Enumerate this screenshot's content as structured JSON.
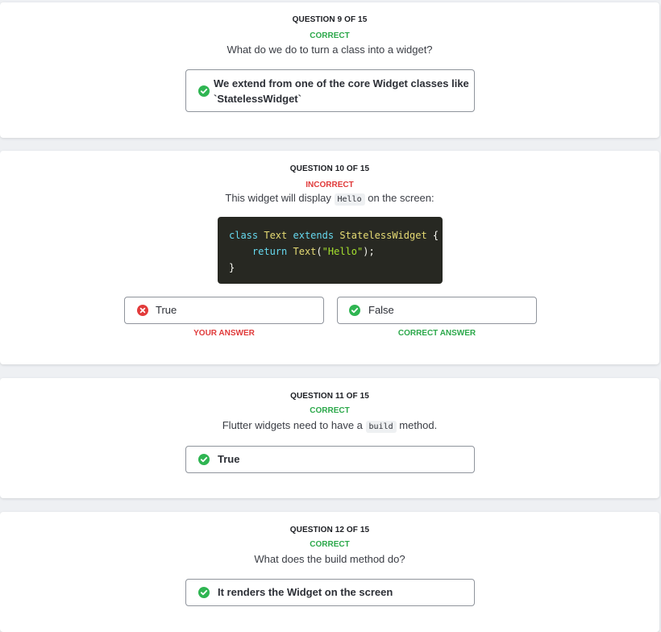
{
  "questions": [
    {
      "number": "QUESTION 9 OF 15",
      "status": "CORRECT",
      "text": "What do we do to turn a class into a widget?",
      "answer": {
        "line1": "We extend from one of the core Widget classes like",
        "line2": "`StatelessWidget`"
      }
    },
    {
      "number": "QUESTION 10 OF 15",
      "status": "INCORRECT",
      "text_before": "This widget will display",
      "code_inline": "Hello",
      "text_after": "on the screen:",
      "code": {
        "l1_kw1": "class",
        "l1_cls1": "Text",
        "l1_kw2": "extends",
        "l1_cls2": "StatelessWidget",
        "l1_brace": "{",
        "l2_kw": "return",
        "l2_cls": "Text",
        "l2_open": "(",
        "l2_str": "\"Hello\"",
        "l2_close": ");",
        "l3": "}"
      },
      "options": [
        {
          "label": "True",
          "tag": "YOUR ANSWER"
        },
        {
          "label": "False",
          "tag": "CORRECT ANSWER"
        }
      ]
    },
    {
      "number": "QUESTION 11 OF 15",
      "status": "CORRECT",
      "text_before": "Flutter widgets need to have a",
      "code_inline": "build",
      "text_after": "method.",
      "answer": "True"
    },
    {
      "number": "QUESTION 12 OF 15",
      "status": "CORRECT",
      "text": "What does the build method do?",
      "answer": "It renders the Widget on the screen"
    }
  ],
  "colors": {
    "correct": "#2ba84a",
    "incorrect": "#e03a3a",
    "code_bg": "#272822"
  },
  "icons": [
    "check-circle-icon",
    "x-circle-icon"
  ]
}
